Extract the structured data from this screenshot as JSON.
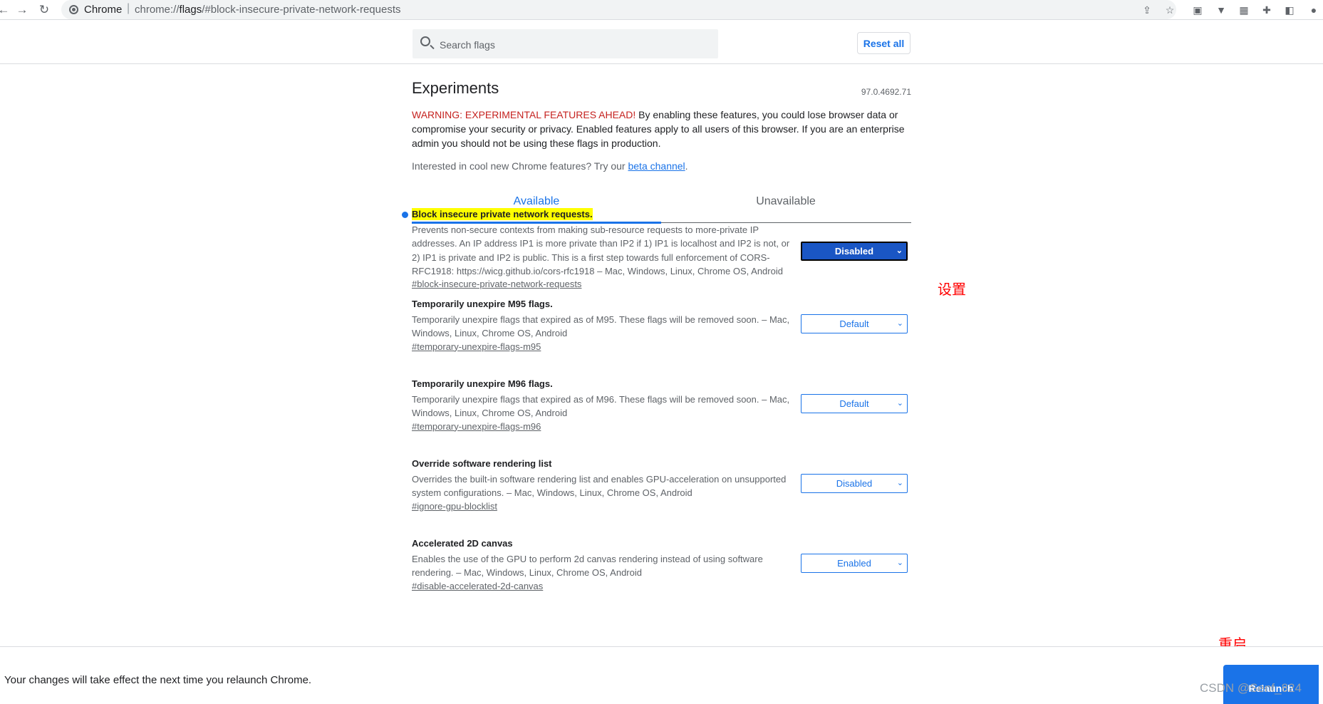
{
  "browser": {
    "scheme_label": "Chrome",
    "url_prefix": "chrome://",
    "url_host": "flags",
    "url_rest": "/#block-insecure-private-network-requests",
    "back_icon": "arrow-left",
    "forward_icon": "arrow-right",
    "reload_icon": "reload"
  },
  "search": {
    "placeholder": "Search flags",
    "reset_label": "Reset all"
  },
  "page": {
    "title": "Experiments",
    "version": "97.0.4692.71",
    "warning_red": "WARNING: EXPERIMENTAL FEATURES AHEAD!",
    "warning_rest": " By enabling these features, you could lose browser data or compromise your security or privacy. Enabled features apply to all users of this browser. If you are an enterprise admin you should not be using these flags in production.",
    "interested_prefix": "Interested in cool new Chrome features? Try our ",
    "interested_link": "beta channel",
    "interested_suffix": "."
  },
  "tabs": {
    "available": "Available",
    "unavailable": "Unavailable"
  },
  "flags": [
    {
      "name": "Block insecure private network requests.",
      "description": "Prevents non-secure contexts from making sub-resource requests to more-private IP addresses. An IP address IP1 is more private than IP2 if 1) IP1 is localhost and IP2 is not, or 2) IP1 is private and IP2 is public. This is a first step towards full enforcement of CORS-RFC1918: https://wicg.github.io/cors-rfc1918 – Mac, Windows, Linux, Chrome OS, Android",
      "link": "#block-insecure-private-network-requests",
      "value": "Disabled"
    },
    {
      "name": "Temporarily unexpire M95 flags.",
      "description": "Temporarily unexpire flags that expired as of M95. These flags will be removed soon. – Mac, Windows, Linux, Chrome OS, Android",
      "link": "#temporary-unexpire-flags-m95",
      "value": "Default"
    },
    {
      "name": "Temporarily unexpire M96 flags.",
      "description": "Temporarily unexpire flags that expired as of M96. These flags will be removed soon. – Mac, Windows, Linux, Chrome OS, Android",
      "link": "#temporary-unexpire-flags-m96",
      "value": "Default"
    },
    {
      "name": "Override software rendering list",
      "description": "Overrides the built-in software rendering list and enables GPU-acceleration on unsupported system configurations. – Mac, Windows, Linux, Chrome OS, Android",
      "link": "#ignore-gpu-blocklist",
      "value": "Disabled"
    },
    {
      "name": "Accelerated 2D canvas",
      "description": "Enables the use of the GPU to perform 2d canvas rendering instead of using software rendering. – Mac, Windows, Linux, Chrome OS, Android",
      "link": "#disable-accelerated-2d-canvas",
      "value": "Enabled"
    }
  ],
  "annotations": {
    "settings": "设置",
    "restart": "重启"
  },
  "bottom": {
    "message": "Your changes will take effect the next time you relaunch Chrome.",
    "relaunch_label": "Relaunch",
    "watermark": "CSDN @Senf_824"
  },
  "colors": {
    "accent": "#1a73e8",
    "warning": "#c5221f",
    "highlight": "#ffff00",
    "annotation": "#ff0000"
  }
}
